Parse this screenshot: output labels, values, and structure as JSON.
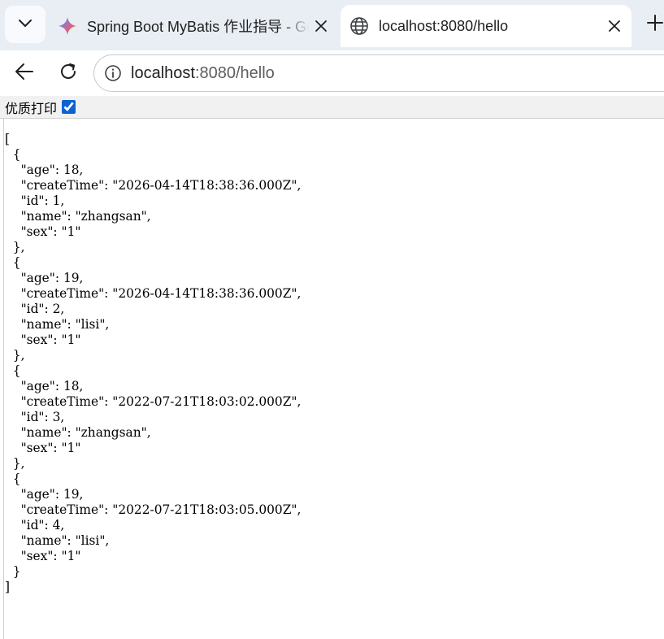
{
  "tabs": [
    {
      "title": "Spring Boot MyBatis 作业指导 - Gemini",
      "favicon": "gemini-sparkle-icon",
      "active": false
    },
    {
      "title": "localhost:8080/hello",
      "favicon": "globe-icon",
      "active": true
    }
  ],
  "address_bar": {
    "host": "localhost",
    "rest": ":8080/hello"
  },
  "viewer": {
    "pretty_print_label": "优质打印",
    "pretty_print_checked": true
  },
  "json_lines": [
    "[",
    "  {",
    "    \"age\": 18,",
    "    \"createTime\": \"2026-04-14T18:38:36.000Z\",",
    "    \"id\": 1,",
    "    \"name\": \"zhangsan\",",
    "    \"sex\": \"1\"",
    "  },",
    "  {",
    "    \"age\": 19,",
    "    \"createTime\": \"2026-04-14T18:38:36.000Z\",",
    "    \"id\": 2,",
    "    \"name\": \"lisi\",",
    "    \"sex\": \"1\"",
    "  },",
    "  {",
    "    \"age\": 18,",
    "    \"createTime\": \"2022-07-21T18:03:02.000Z\",",
    "    \"id\": 3,",
    "    \"name\": \"zhangsan\",",
    "    \"sex\": \"1\"",
    "  },",
    "  {",
    "    \"age\": 19,",
    "    \"createTime\": \"2022-07-21T18:03:05.000Z\",",
    "    \"id\": 4,",
    "    \"name\": \"lisi\",",
    "    \"sex\": \"1\"",
    "  }",
    "]"
  ],
  "colors": {
    "tabstrip_bg": "#e9eef5",
    "accent": "#0b63d1"
  }
}
